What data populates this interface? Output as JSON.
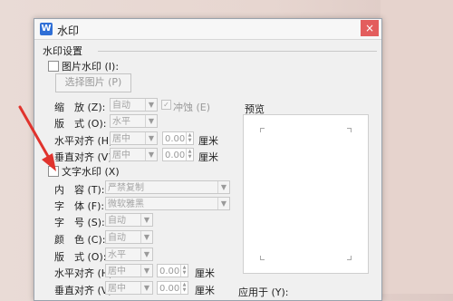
{
  "dialog": {
    "title": "水印",
    "app_icon": "W",
    "close": "×"
  },
  "group": {
    "title": "水印设置"
  },
  "image_wm": {
    "checkbox_label": "图片水印 (I):",
    "select_btn": "选择图片 (P)",
    "scale_label": "缩　放 (Z):",
    "scale_value": "自动",
    "washout_label": "冲蚀 (E)",
    "layout_label": "版　式 (O):",
    "layout_value": "水平",
    "halign_label": "水平对齐 (H):",
    "halign_value": "居中",
    "halign_offset": "0.00",
    "valign_label": "垂直对齐 (V):",
    "valign_value": "居中",
    "valign_offset": "0.00",
    "unit": "厘米"
  },
  "text_wm": {
    "checkbox_label": "文字水印 (X)",
    "content_label": "内　容 (T):",
    "content_value": "严禁复制",
    "font_label": "字　体 (F):",
    "font_value": "微软雅黑",
    "size_label": "字　号 (S):",
    "size_value": "自动",
    "color_label": "颜　色 (C):",
    "color_value": "自动",
    "layout_label": "版　式 (O):",
    "layout_value": "水平",
    "halign_label": "水平对齐 (H):",
    "halign_value": "居中",
    "halign_offset": "0.00",
    "valign_label": "垂直对齐 (V):",
    "valign_value": "居中",
    "valign_offset": "0.00",
    "unit": "厘米"
  },
  "preview": {
    "label": "预览"
  },
  "apply_to": {
    "label": "应用于 (Y):"
  },
  "colors": {
    "arrow": "#e0332d",
    "close_bg": "#e35d5d",
    "app_icon": "#2f6fd6"
  }
}
